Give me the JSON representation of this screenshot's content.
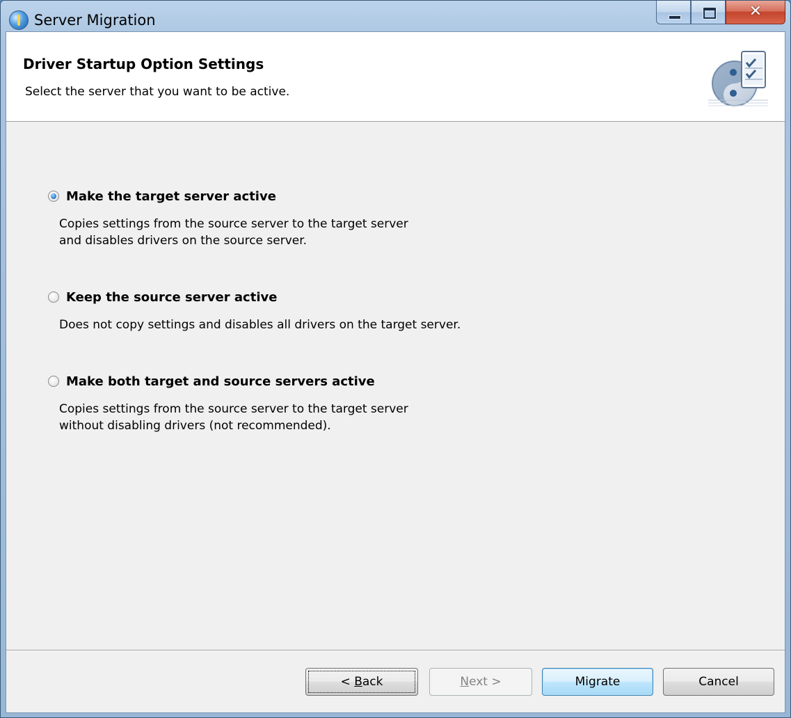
{
  "window": {
    "title": "Server Migration"
  },
  "header": {
    "title": "Driver Startup Option Settings",
    "subtitle": "Select the server that you want to be active."
  },
  "options": [
    {
      "label": "Make the target server active",
      "checked": true,
      "description_lines": [
        "Copies settings from the source server to the target server",
        "and disables drivers on the source server."
      ]
    },
    {
      "label": "Keep the source server active",
      "checked": false,
      "description_lines": [
        "Does not copy settings and disables all drivers on the target server."
      ]
    },
    {
      "label": "Make both target and source servers active",
      "checked": false,
      "description_lines": [
        "Copies settings from the source server to the target server",
        "without disabling drivers (not recommended)."
      ]
    }
  ],
  "buttons": {
    "back_prefix": "< ",
    "back_mnemonic": "B",
    "back_rest": "ack",
    "next_mnemonic": "N",
    "next_rest": "ext >",
    "migrate": "Migrate",
    "cancel": "Cancel"
  },
  "colors": {
    "client_bg": "#f0f0f0",
    "header_bg": "#ffffff",
    "close_button": "#c4442b",
    "default_button_border": "#3c7fb1"
  }
}
